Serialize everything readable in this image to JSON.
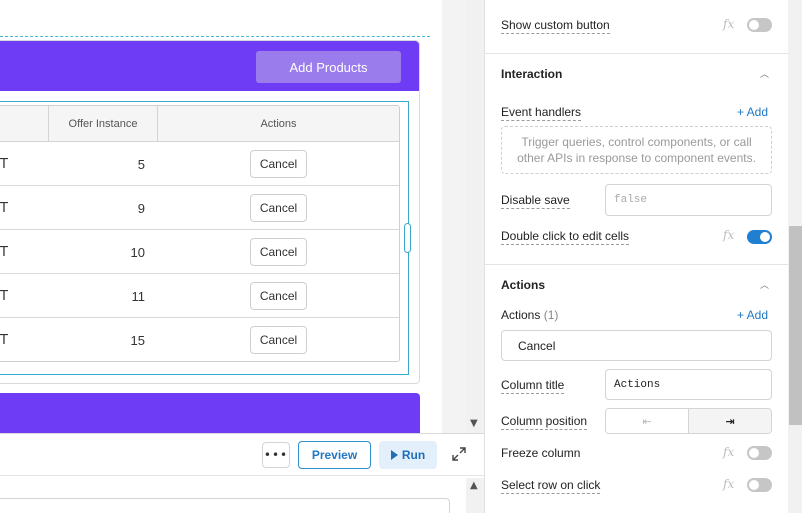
{
  "canvas": {
    "add_products_label": "Add Products",
    "table": {
      "headers": {
        "offer_instance": "Offer Instance",
        "actions": "Actions"
      },
      "rows": [
        {
          "prefix": "T",
          "offer_instance": "5",
          "action": "Cancel"
        },
        {
          "prefix": "T",
          "offer_instance": "9",
          "action": "Cancel"
        },
        {
          "prefix": "T",
          "offer_instance": "10",
          "action": "Cancel"
        },
        {
          "prefix": "T",
          "offer_instance": "11",
          "action": "Cancel"
        },
        {
          "prefix": "T",
          "offer_instance": "15",
          "action": "Cancel"
        }
      ]
    },
    "accent_color": "#6f3cf5"
  },
  "query_panel": {
    "more_label": "•••",
    "preview_label": "Preview",
    "run_label": "Run"
  },
  "inspector": {
    "show_custom_button": {
      "label": "Show custom button",
      "fx": "fx",
      "enabled": false
    },
    "interaction": {
      "title": "Interaction",
      "event_handlers_label": "Event handlers",
      "add_label": "+ Add",
      "event_handlers_empty": "Trigger queries, control components, or call other APIs in response to component events.",
      "disable_save_label": "Disable save",
      "disable_save_value": "false",
      "double_click_label": "Double click to edit cells",
      "double_click_fx": "fx",
      "double_click_enabled": true
    },
    "actions": {
      "title": "Actions",
      "actions_label": "Actions",
      "actions_count": "(1)",
      "add_label": "+ Add",
      "action_item": "Cancel",
      "column_title_label": "Column title",
      "column_title_value": "Actions",
      "column_position_label": "Column position",
      "position_left_icon": "⇤",
      "position_right_icon": "⇥",
      "freeze_column_label": "Freeze column",
      "freeze_fx": "fx",
      "freeze_enabled": false,
      "select_row_label": "Select row on click",
      "select_row_fx": "fx",
      "select_row_enabled": false
    },
    "toggle_on_color": "#1f7fd0"
  }
}
